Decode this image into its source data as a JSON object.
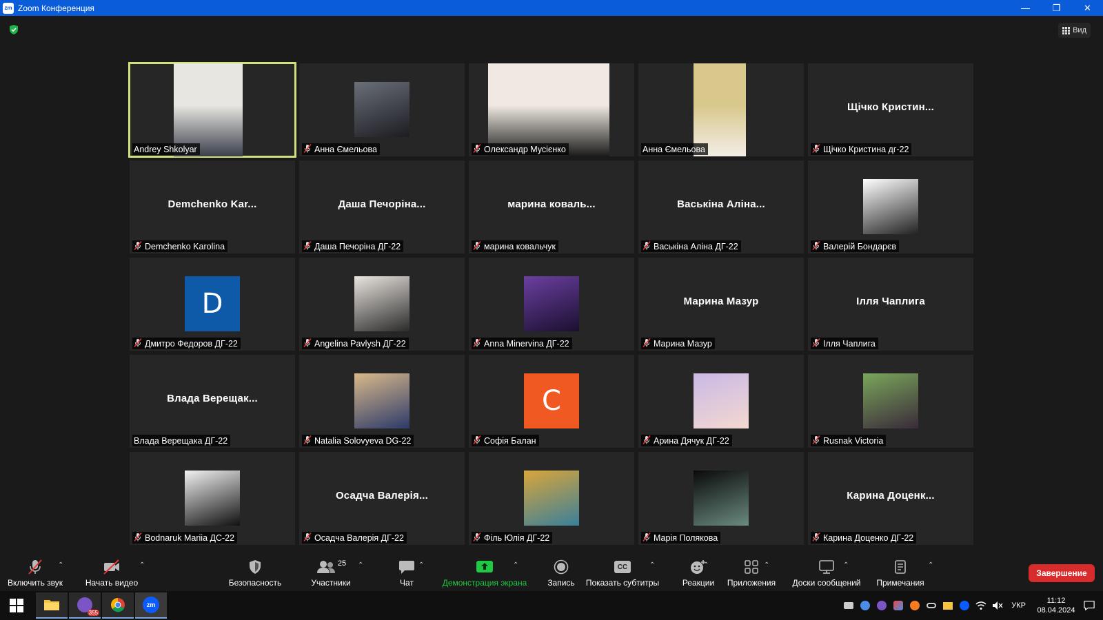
{
  "window": {
    "logo": "zm",
    "title": "Zoom Конференция",
    "minimize": "—",
    "restore": "❐",
    "close": "✕"
  },
  "view_button": "Вид",
  "participants": [
    {
      "name": "Andrey Shkolyar",
      "type": "video",
      "muted": false,
      "active": true,
      "colors": [
        "#e8e6e1",
        "#3a3f4a"
      ]
    },
    {
      "name": "Анна Ємельова",
      "type": "photo",
      "muted": true,
      "colors": [
        "#6a6f78",
        "#1c1c22"
      ]
    },
    {
      "name": "Олександр Мусієнко",
      "type": "video",
      "muted": true,
      "colors": [
        "#efe9e1",
        "#1b1b1b"
      ]
    },
    {
      "name": "Анна Ємельова",
      "type": "video",
      "muted": false,
      "colors": [
        "#d8c88c",
        "#f2ede6"
      ]
    },
    {
      "name": "Щічко Кристина дг-22",
      "display": "Щічко  Кристин...",
      "type": "name",
      "muted": true
    },
    {
      "name": "Demchenko Karolina",
      "display": "Demchenko  Kar...",
      "type": "name",
      "muted": true
    },
    {
      "name": "Даша Печоріна ДГ-22",
      "display": "Даша  Печоріна...",
      "type": "name",
      "muted": true
    },
    {
      "name": "марина ковальчук",
      "display": "марина  коваль...",
      "type": "name",
      "muted": true
    },
    {
      "name": "Васькіна Аліна ДГ-22",
      "display": "Васькіна  Аліна...",
      "type": "name",
      "muted": true
    },
    {
      "name": "Валерій Бондарєв",
      "type": "photo",
      "muted": true,
      "colors": [
        "#ffffff",
        "#222222"
      ]
    },
    {
      "name": "Дмитро Федоров ДГ-22",
      "type": "letter",
      "letter": "D",
      "muted": true,
      "colors": [
        "#0f5aa8"
      ]
    },
    {
      "name": "Angelina Pavlysh ДГ-22",
      "type": "photo",
      "muted": true,
      "colors": [
        "#e9e4de",
        "#2b2b2b"
      ]
    },
    {
      "name": "Anna Minervina ДГ-22",
      "type": "photo",
      "muted": true,
      "colors": [
        "#6b3fa0",
        "#1a1030"
      ]
    },
    {
      "name": "Марина Мазур",
      "display": "Марина Мазур",
      "type": "name",
      "muted": true
    },
    {
      "name": "Ілля Чаплига",
      "display": "Ілля Чаплига",
      "type": "name",
      "muted": true
    },
    {
      "name": "Влада Верещака ДГ-22",
      "display": "Влада  Верещак...",
      "type": "name",
      "muted": false
    },
    {
      "name": "Natalia Solovyeva DG-22",
      "type": "photo",
      "muted": true,
      "colors": [
        "#d9b98a",
        "#2c3a6a"
      ]
    },
    {
      "name": "Софія Балан",
      "type": "letter",
      "letter": "C",
      "muted": true,
      "colors": [
        "#f05a22"
      ]
    },
    {
      "name": "Арина Дячук ДГ-22",
      "type": "photo",
      "muted": true,
      "colors": [
        "#c9b9e6",
        "#f4d8d0"
      ]
    },
    {
      "name": "Rusnak Victoria",
      "type": "photo",
      "muted": true,
      "colors": [
        "#7aa65a",
        "#3a2a3a"
      ]
    },
    {
      "name": "Bodnaruk Mariia ДС-22",
      "type": "photo",
      "muted": true,
      "colors": [
        "#f2f2f2",
        "#111111"
      ]
    },
    {
      "name": "Осадча Валерія ДГ-22",
      "display": "Осадча  Валерія...",
      "type": "name",
      "muted": true
    },
    {
      "name": "Філь Юлія ДГ-22",
      "type": "photo",
      "muted": true,
      "colors": [
        "#d9a63a",
        "#3a7f9a"
      ]
    },
    {
      "name": "Марія Полякова",
      "type": "photo",
      "muted": true,
      "colors": [
        "#0a0a0a",
        "#6a8a80"
      ]
    },
    {
      "name": "Карина Доценко ДГ-22",
      "display": "Карина  Доценк...",
      "type": "name",
      "muted": true
    }
  ],
  "toolbar": {
    "audio": "Включить звук",
    "video": "Начать видео",
    "security": "Безопасность",
    "participants": "Участники",
    "participants_count": "25",
    "chat": "Чат",
    "share": "Демонстрация экрана",
    "record": "Запись",
    "captions": "Показать субтитры",
    "captions_icon": "CC",
    "reactions": "Реакции",
    "apps": "Приложения",
    "whiteboards": "Доски сообщений",
    "notes": "Примечания",
    "end": "Завершение",
    "share_color": "#1ec943"
  },
  "taskbar": {
    "viber_badge": "355",
    "zoom_label": "zm",
    "language": "УКР",
    "time": "11:12",
    "date": "08.04.2024"
  }
}
